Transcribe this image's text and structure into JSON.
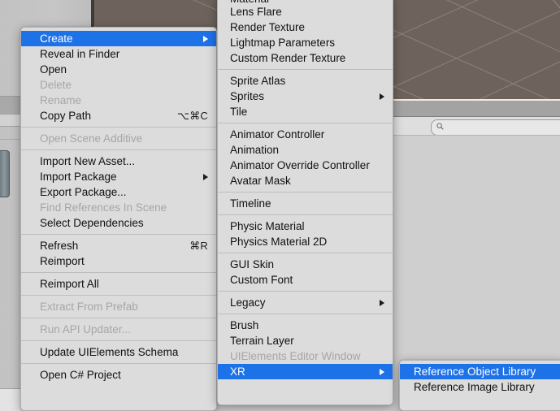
{
  "background": {
    "app": "Unity Editor",
    "search": {
      "placeholder": "",
      "value": "",
      "icon": "search-icon"
    },
    "scene_view": {
      "label": ""
    }
  },
  "menus": {
    "assets_context_menu": {
      "name": "Assets context menu",
      "items": [
        {
          "label": "Create",
          "type": "item",
          "submenu": true,
          "selected": true,
          "disabled": false,
          "shortcut": ""
        },
        {
          "label": "Reveal in Finder",
          "type": "item",
          "submenu": false,
          "selected": false,
          "disabled": false,
          "shortcut": ""
        },
        {
          "label": "Open",
          "type": "item",
          "submenu": false,
          "selected": false,
          "disabled": false,
          "shortcut": ""
        },
        {
          "label": "Delete",
          "type": "item",
          "submenu": false,
          "selected": false,
          "disabled": true,
          "shortcut": ""
        },
        {
          "label": "Rename",
          "type": "item",
          "submenu": false,
          "selected": false,
          "disabled": true,
          "shortcut": ""
        },
        {
          "label": "Copy Path",
          "type": "item",
          "submenu": false,
          "selected": false,
          "disabled": false,
          "shortcut": "⌥⌘C"
        },
        {
          "type": "separator"
        },
        {
          "label": "Open Scene Additive",
          "type": "item",
          "submenu": false,
          "selected": false,
          "disabled": true,
          "shortcut": ""
        },
        {
          "type": "separator"
        },
        {
          "label": "Import New Asset...",
          "type": "item",
          "submenu": false,
          "selected": false,
          "disabled": false,
          "shortcut": ""
        },
        {
          "label": "Import Package",
          "type": "item",
          "submenu": true,
          "selected": false,
          "disabled": false,
          "shortcut": ""
        },
        {
          "label": "Export Package...",
          "type": "item",
          "submenu": false,
          "selected": false,
          "disabled": false,
          "shortcut": ""
        },
        {
          "label": "Find References In Scene",
          "type": "item",
          "submenu": false,
          "selected": false,
          "disabled": true,
          "shortcut": ""
        },
        {
          "label": "Select Dependencies",
          "type": "item",
          "submenu": false,
          "selected": false,
          "disabled": false,
          "shortcut": ""
        },
        {
          "type": "separator"
        },
        {
          "label": "Refresh",
          "type": "item",
          "submenu": false,
          "selected": false,
          "disabled": false,
          "shortcut": "⌘R"
        },
        {
          "label": "Reimport",
          "type": "item",
          "submenu": false,
          "selected": false,
          "disabled": false,
          "shortcut": ""
        },
        {
          "type": "separator"
        },
        {
          "label": "Reimport All",
          "type": "item",
          "submenu": false,
          "selected": false,
          "disabled": false,
          "shortcut": ""
        },
        {
          "type": "separator"
        },
        {
          "label": "Extract From Prefab",
          "type": "item",
          "submenu": false,
          "selected": false,
          "disabled": true,
          "shortcut": ""
        },
        {
          "type": "separator"
        },
        {
          "label": "Run API Updater...",
          "type": "item",
          "submenu": false,
          "selected": false,
          "disabled": true,
          "shortcut": ""
        },
        {
          "type": "separator"
        },
        {
          "label": "Update UIElements Schema",
          "type": "item",
          "submenu": false,
          "selected": false,
          "disabled": false,
          "shortcut": ""
        },
        {
          "type": "separator"
        },
        {
          "label": "Open C# Project",
          "type": "item",
          "submenu": false,
          "selected": false,
          "disabled": false,
          "shortcut": ""
        }
      ]
    },
    "create_submenu": {
      "name": "Create submenu",
      "items": [
        {
          "label": "Material",
          "type": "item",
          "submenu": false,
          "selected": false,
          "disabled": false,
          "shortcut": "",
          "clipped": true
        },
        {
          "label": "Lens Flare",
          "type": "item",
          "submenu": false,
          "selected": false,
          "disabled": false,
          "shortcut": ""
        },
        {
          "label": "Render Texture",
          "type": "item",
          "submenu": false,
          "selected": false,
          "disabled": false,
          "shortcut": ""
        },
        {
          "label": "Lightmap Parameters",
          "type": "item",
          "submenu": false,
          "selected": false,
          "disabled": false,
          "shortcut": ""
        },
        {
          "label": "Custom Render Texture",
          "type": "item",
          "submenu": false,
          "selected": false,
          "disabled": false,
          "shortcut": ""
        },
        {
          "type": "separator"
        },
        {
          "label": "Sprite Atlas",
          "type": "item",
          "submenu": false,
          "selected": false,
          "disabled": false,
          "shortcut": ""
        },
        {
          "label": "Sprites",
          "type": "item",
          "submenu": true,
          "selected": false,
          "disabled": false,
          "shortcut": ""
        },
        {
          "label": "Tile",
          "type": "item",
          "submenu": false,
          "selected": false,
          "disabled": false,
          "shortcut": ""
        },
        {
          "type": "separator"
        },
        {
          "label": "Animator Controller",
          "type": "item",
          "submenu": false,
          "selected": false,
          "disabled": false,
          "shortcut": ""
        },
        {
          "label": "Animation",
          "type": "item",
          "submenu": false,
          "selected": false,
          "disabled": false,
          "shortcut": ""
        },
        {
          "label": "Animator Override Controller",
          "type": "item",
          "submenu": false,
          "selected": false,
          "disabled": false,
          "shortcut": ""
        },
        {
          "label": "Avatar Mask",
          "type": "item",
          "submenu": false,
          "selected": false,
          "disabled": false,
          "shortcut": ""
        },
        {
          "type": "separator"
        },
        {
          "label": "Timeline",
          "type": "item",
          "submenu": false,
          "selected": false,
          "disabled": false,
          "shortcut": ""
        },
        {
          "type": "separator"
        },
        {
          "label": "Physic Material",
          "type": "item",
          "submenu": false,
          "selected": false,
          "disabled": false,
          "shortcut": ""
        },
        {
          "label": "Physics Material 2D",
          "type": "item",
          "submenu": false,
          "selected": false,
          "disabled": false,
          "shortcut": ""
        },
        {
          "type": "separator"
        },
        {
          "label": "GUI Skin",
          "type": "item",
          "submenu": false,
          "selected": false,
          "disabled": false,
          "shortcut": ""
        },
        {
          "label": "Custom Font",
          "type": "item",
          "submenu": false,
          "selected": false,
          "disabled": false,
          "shortcut": ""
        },
        {
          "type": "separator"
        },
        {
          "label": "Legacy",
          "type": "item",
          "submenu": true,
          "selected": false,
          "disabled": false,
          "shortcut": ""
        },
        {
          "type": "separator"
        },
        {
          "label": "Brush",
          "type": "item",
          "submenu": false,
          "selected": false,
          "disabled": false,
          "shortcut": ""
        },
        {
          "label": "Terrain Layer",
          "type": "item",
          "submenu": false,
          "selected": false,
          "disabled": false,
          "shortcut": ""
        },
        {
          "label": "UIElements Editor Window",
          "type": "item",
          "submenu": false,
          "selected": false,
          "disabled": true,
          "shortcut": ""
        },
        {
          "label": "XR",
          "type": "item",
          "submenu": true,
          "selected": true,
          "disabled": false,
          "shortcut": ""
        }
      ]
    },
    "xr_submenu": {
      "name": "XR submenu",
      "items": [
        {
          "label": "Reference Object Library",
          "type": "item",
          "submenu": false,
          "selected": true,
          "disabled": false,
          "shortcut": ""
        },
        {
          "label": "Reference Image Library",
          "type": "item",
          "submenu": false,
          "selected": false,
          "disabled": false,
          "shortcut": ""
        }
      ]
    }
  },
  "colors": {
    "selection_blue": "#1d72e8",
    "menu_background": "#dcdcdc",
    "disabled_text": "#a6a6a6",
    "text": "#101010",
    "scene_background": "#6d635c"
  }
}
